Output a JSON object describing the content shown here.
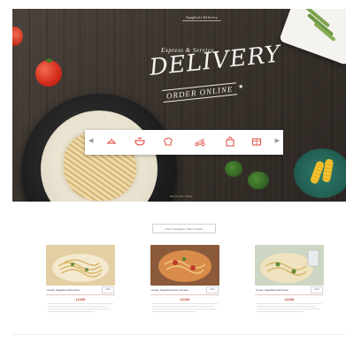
{
  "hero": {
    "brand": "Spaghetti Delivery",
    "eyebrow": "Express & Service",
    "headline": "DELIVERY",
    "cta": "ORDER ONLINE",
    "caption": "Scroll for more"
  },
  "categories": [
    {
      "icon": "meal-icon"
    },
    {
      "icon": "bowl-icon"
    },
    {
      "icon": "chef-hat-icon"
    },
    {
      "icon": "scooter-icon"
    },
    {
      "icon": "bag-icon"
    },
    {
      "icon": "box-icon"
    }
  ],
  "menu": {
    "button_label": "View Spaghetti Best Pasta",
    "items": [
      {
        "name": "Cream Spaghetti with Pesto",
        "tag": "NEW",
        "price": "12,000"
      },
      {
        "name": "Cream Spaghetti Pesto Tomato",
        "tag": "NEW",
        "price": "10,000"
      },
      {
        "name": "Cream Spaghetti with Pesto",
        "tag": "NEW",
        "price": "10,000"
      }
    ]
  },
  "colors": {
    "accent": "#e05a50",
    "hero_wood": "#3a332d",
    "price": "#c0392b"
  }
}
